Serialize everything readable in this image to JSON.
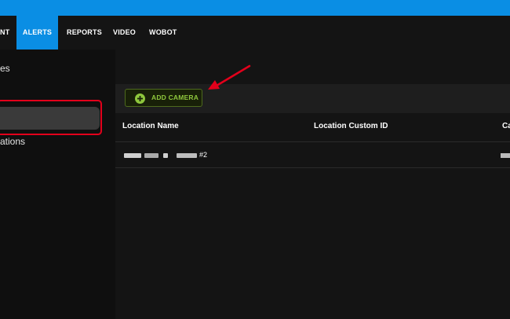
{
  "nav": {
    "items": [
      {
        "label": "NT",
        "active": false
      },
      {
        "label": "ALERTS",
        "active": true
      },
      {
        "label": "REPORTS",
        "active": false
      },
      {
        "label": "VIDEO",
        "active": false
      },
      {
        "label": "WOBOT",
        "active": false
      }
    ]
  },
  "sidebar": {
    "heading": "es",
    "item2": "ations"
  },
  "toolbar": {
    "add_camera_label": "ADD CAMERA"
  },
  "table": {
    "columns": [
      "Location Name",
      "Location Custom ID",
      "Ca"
    ],
    "rows": [
      {
        "location_suffix": "#2"
      }
    ]
  },
  "colors": {
    "accent_blue": "#0a8ee4",
    "add_green": "#8ec73d",
    "highlight_red": "#e3001b"
  }
}
